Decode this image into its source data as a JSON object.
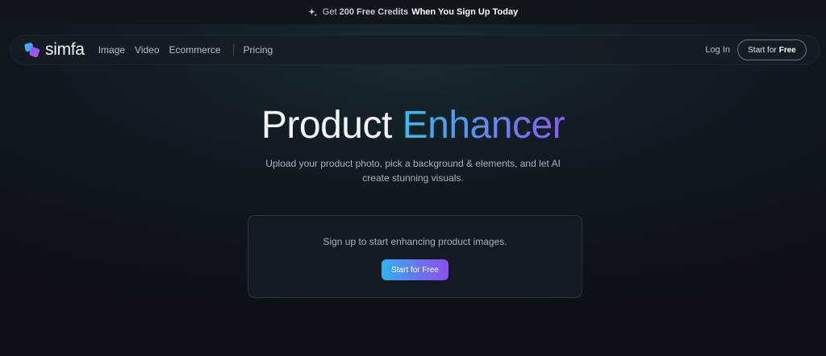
{
  "promo": {
    "prefix": "Get",
    "credits": "200 Free Credits",
    "suffix": "When You Sign Up Today",
    "icon": "sparkle-icon"
  },
  "nav": {
    "logo_text": "simfa",
    "logo_icon": "simfa-logo-icon",
    "links": [
      "Image",
      "Video",
      "Ecommerce",
      "Pricing"
    ],
    "login": "Log In",
    "start_prefix": "Start for",
    "start_bold": "Free"
  },
  "hero": {
    "title_1": "Product",
    "title_2": "Enhancer",
    "subtitle": "Upload your product photo, pick a background & elements, and let AI create stunning visuals."
  },
  "card": {
    "text": "Sign up to start enhancing product images.",
    "cta": "Start for Free"
  },
  "colors": {
    "background": "#0d1117",
    "gradient_start": "#3bbcf0",
    "gradient_end": "#8b5cf6"
  }
}
